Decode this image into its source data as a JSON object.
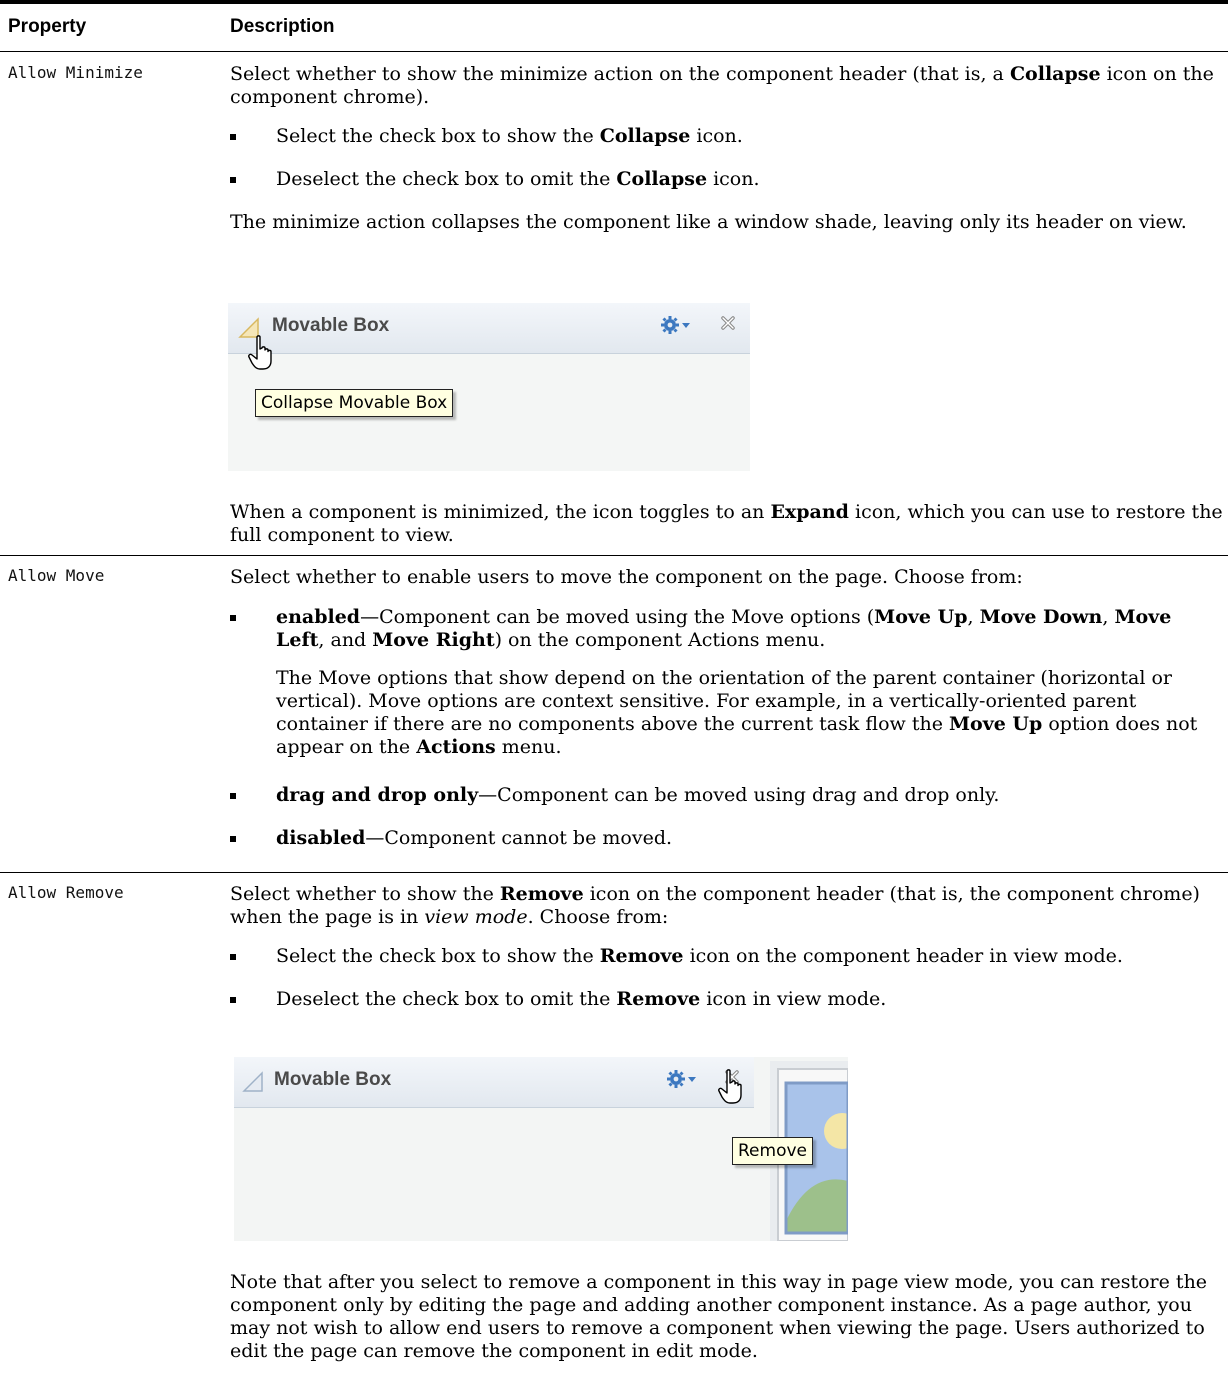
{
  "table": {
    "headers": {
      "property": "Property",
      "description": "Description"
    },
    "rows": [
      {
        "property": "Allow Minimize",
        "intro": [
          "Select whether to show the minimize action on the component header (that is, a ",
          "Collapse",
          " icon on the component chrome)."
        ],
        "bullets": [
          [
            "Select the check box to show the ",
            "Collapse",
            " icon."
          ],
          [
            "Deselect the check box to omit the ",
            "Collapse",
            " icon."
          ]
        ],
        "after": "The minimize action collapses the component like a window shade, leaving only its header on view.",
        "figure": {
          "title": "Movable Box",
          "tooltip": "Collapse Movable Box"
        },
        "closing": [
          "When a component is minimized, the icon toggles to an ",
          "Expand",
          " icon, which you can use to restore the full component to view."
        ]
      },
      {
        "property": "Allow Move",
        "intro": "Select whether to enable users to move the component on the page. Choose from:",
        "bullet1": {
          "term": "enabled",
          "text_a": "—Component can be moved using the Move options (",
          "opt1": "Move Up",
          "sep1": ", ",
          "opt2": "Move Down",
          "sep2": ", ",
          "opt3": "Move Left",
          "sep3": ", and ",
          "opt4": "Move Right",
          "text_b": ") on the component Actions menu.",
          "sub_a": "The Move options that show depend on the orientation of the parent container (horizontal or vertical). Move options are context sensitive. For example, in a vertically-oriented parent container if there are no components above the current task flow the ",
          "sub_b1": "Move Up",
          "sub_c": " option does not appear on the ",
          "sub_b2": "Actions",
          "sub_d": " menu."
        },
        "bullet2": {
          "term": "drag and drop only",
          "text": "—Component can be moved using drag and drop only."
        },
        "bullet3": {
          "term": "disabled",
          "text": "—Component cannot be moved."
        }
      },
      {
        "property": "Allow Remove",
        "intro_a": "Select whether to show the ",
        "intro_b": "Remove",
        "intro_c": " icon on the component header (that is, the component chrome) when the page is in ",
        "intro_d": "view mode",
        "intro_e": ". Choose from:",
        "bullets": [
          [
            "Select the check box to show the ",
            "Remove",
            " icon on the component header in view mode."
          ],
          [
            "Deselect the check box to omit the ",
            "Remove",
            " icon in view mode."
          ]
        ],
        "figure": {
          "title": "Movable Box",
          "tooltip": "Remove"
        },
        "note": "Note that after you select to remove a component in this way in page view mode, you can restore the component only by editing the page and adding another component instance. As a page author, you may not wish to allow end users to remove a component when viewing the page. Users authorized to edit the page can remove the component in edit mode."
      }
    ]
  }
}
